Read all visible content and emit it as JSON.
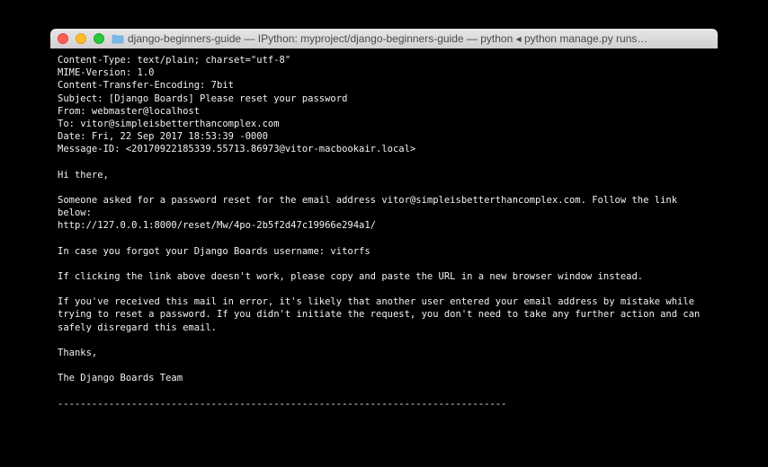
{
  "window": {
    "title": "django-beginners-guide — IPython: myproject/django-beginners-guide — python ◂ python manage.py runs…"
  },
  "terminal": {
    "output": "Content-Type: text/plain; charset=\"utf-8\"\nMIME-Version: 1.0\nContent-Transfer-Encoding: 7bit\nSubject: [Django Boards] Please reset your password\nFrom: webmaster@localhost\nTo: vitor@simpleisbetterthancomplex.com\nDate: Fri, 22 Sep 2017 18:53:39 -0000\nMessage-ID: <20170922185339.55713.86973@vitor-macbookair.local>\n\nHi there,\n\nSomeone asked for a password reset for the email address vitor@simpleisbetterthancomplex.com. Follow the link below:\nhttp://127.0.0.1:8000/reset/Mw/4po-2b5f2d47c19966e294a1/\n\nIn case you forgot your Django Boards username: vitorfs\n\nIf clicking the link above doesn't work, please copy and paste the URL in a new browser window instead.\n\nIf you've received this mail in error, it's likely that another user entered your email address by mistake while trying to reset a password. If you didn't initiate the request, you don't need to take any further action and can safely disregard this email.\n\nThanks,\n\nThe Django Boards Team\n\n-------------------------------------------------------------------------------"
  }
}
